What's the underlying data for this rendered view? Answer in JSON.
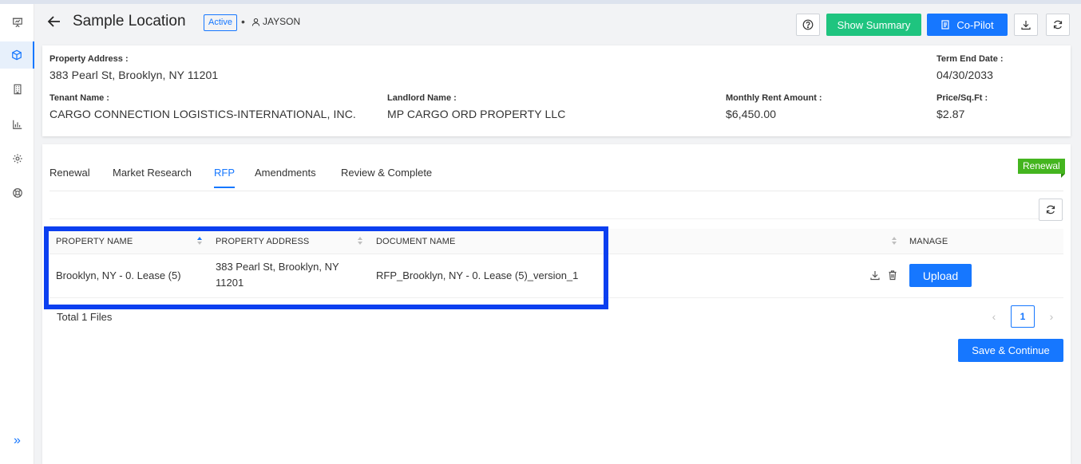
{
  "header": {
    "title": "Sample Location",
    "status": "Active",
    "separator": "•",
    "user": "JAYSON",
    "show_summary_label": "Show Summary",
    "copilot_label": "Co-Pilot"
  },
  "lease": {
    "property_address_label": "Property Address :",
    "property_address": "383 Pearl St, Brooklyn, NY 11201",
    "term_end_label": "Term End Date :",
    "term_end": "04/30/2033",
    "tenant_label": "Tenant Name :",
    "tenant": "CARGO CONNECTION LOGISTICS-INTERNATIONAL, INC.",
    "landlord_label": "Landlord Name :",
    "landlord": "MP CARGO ORD PROPERTY LLC",
    "rent_label": "Monthly Rent Amount :",
    "rent": "$6,450.00",
    "price_label": "Price/Sq.Ft :",
    "price": "$2.87"
  },
  "tabs": [
    "Renewal",
    "Market Research",
    "RFP",
    "Amendments",
    "Review & Complete"
  ],
  "active_tab": "RFP",
  "ribbon": "Renewal",
  "table": {
    "columns": [
      "PROPERTY NAME",
      "PROPERTY ADDRESS",
      "DOCUMENT NAME",
      "MANAGE"
    ],
    "rows": [
      {
        "property_name": "Brooklyn, NY - 0. Lease (5)",
        "address_line1": "383 Pearl St, Brooklyn, NY",
        "address_line2": "11201",
        "document_name": "RFP_Brooklyn, NY - 0. Lease (5)_version_1",
        "upload_label": "Upload"
      }
    ]
  },
  "footer": {
    "total": "Total 1 Files",
    "page": "1",
    "prev": "‹",
    "next": "›",
    "save_label": "Save & Continue"
  },
  "colors": {
    "primary": "#1677ff",
    "success": "#1fc47f",
    "ribbon": "#44b51f",
    "highlight": "#0b3ff0"
  },
  "icons": {
    "sidebar": [
      "presentation-icon",
      "cube-icon",
      "building-icon",
      "bar-chart-icon",
      "gear-icon",
      "support-icon"
    ],
    "expand": "double-chevron-right-icon"
  }
}
